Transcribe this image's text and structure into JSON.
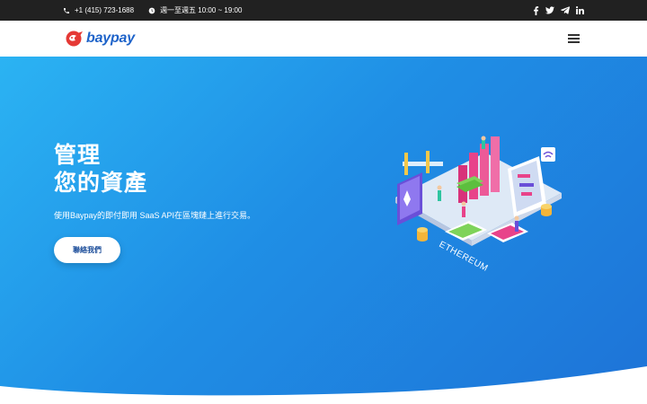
{
  "topbar": {
    "phone": "+1 (415) 723-1688",
    "hours": "週一至週五 10:00 ~ 19:00",
    "social": [
      "facebook-icon",
      "twitter-icon",
      "telegram-icon",
      "linkedin-icon"
    ]
  },
  "header": {
    "logo_text": "baypay",
    "menu_icon": "hamburger-icon"
  },
  "hero": {
    "title_line1": "管理",
    "title_line2": "您的資產",
    "description": "使用Baypay的即付即用 SaaS API在區塊鏈上進行交易。",
    "cta_label": "聯絡我們",
    "illustration_text": "ETHEREUM"
  },
  "colors": {
    "topbar_bg": "#212121",
    "hero_gradient_start": "#2bb3f3",
    "hero_gradient_end": "#1e73d7",
    "brand_blue": "#1e63c9",
    "brand_red": "#e53935"
  }
}
